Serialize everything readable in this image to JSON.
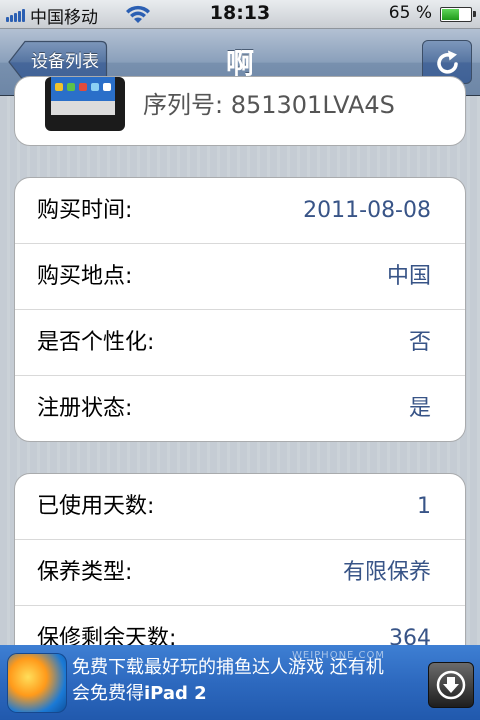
{
  "status_bar": {
    "carrier": "中国移动",
    "time": "18:13",
    "battery_percent": "65 %",
    "battery_level": 0.65
  },
  "nav": {
    "back_label": "设备列表",
    "title": "啊"
  },
  "device": {
    "serial_text": "序列号: 851301LVA4S"
  },
  "group1": [
    {
      "label": "购买时间:",
      "value": "2011-08-08"
    },
    {
      "label": "购买地点:",
      "value": "中国"
    },
    {
      "label": "是否个性化:",
      "value": "否"
    },
    {
      "label": "注册状态:",
      "value": "是"
    }
  ],
  "group2": [
    {
      "label": "已使用天数:",
      "value": "1"
    },
    {
      "label": "保养类型:",
      "value": "有限保养"
    },
    {
      "label": "保修剩余天数:",
      "value": "364"
    }
  ],
  "ad": {
    "line1": "免费下载最好玩的捕鱼达人游戏 还有机",
    "line2_prefix": "会免费得",
    "line2_bold": "iPad 2",
    "watermark": "WEIPHONE.COM"
  },
  "colors": {
    "value_text": "#385487",
    "nav_gradient_mid": "#7890ae",
    "ad_blue": "#2d69bf"
  }
}
